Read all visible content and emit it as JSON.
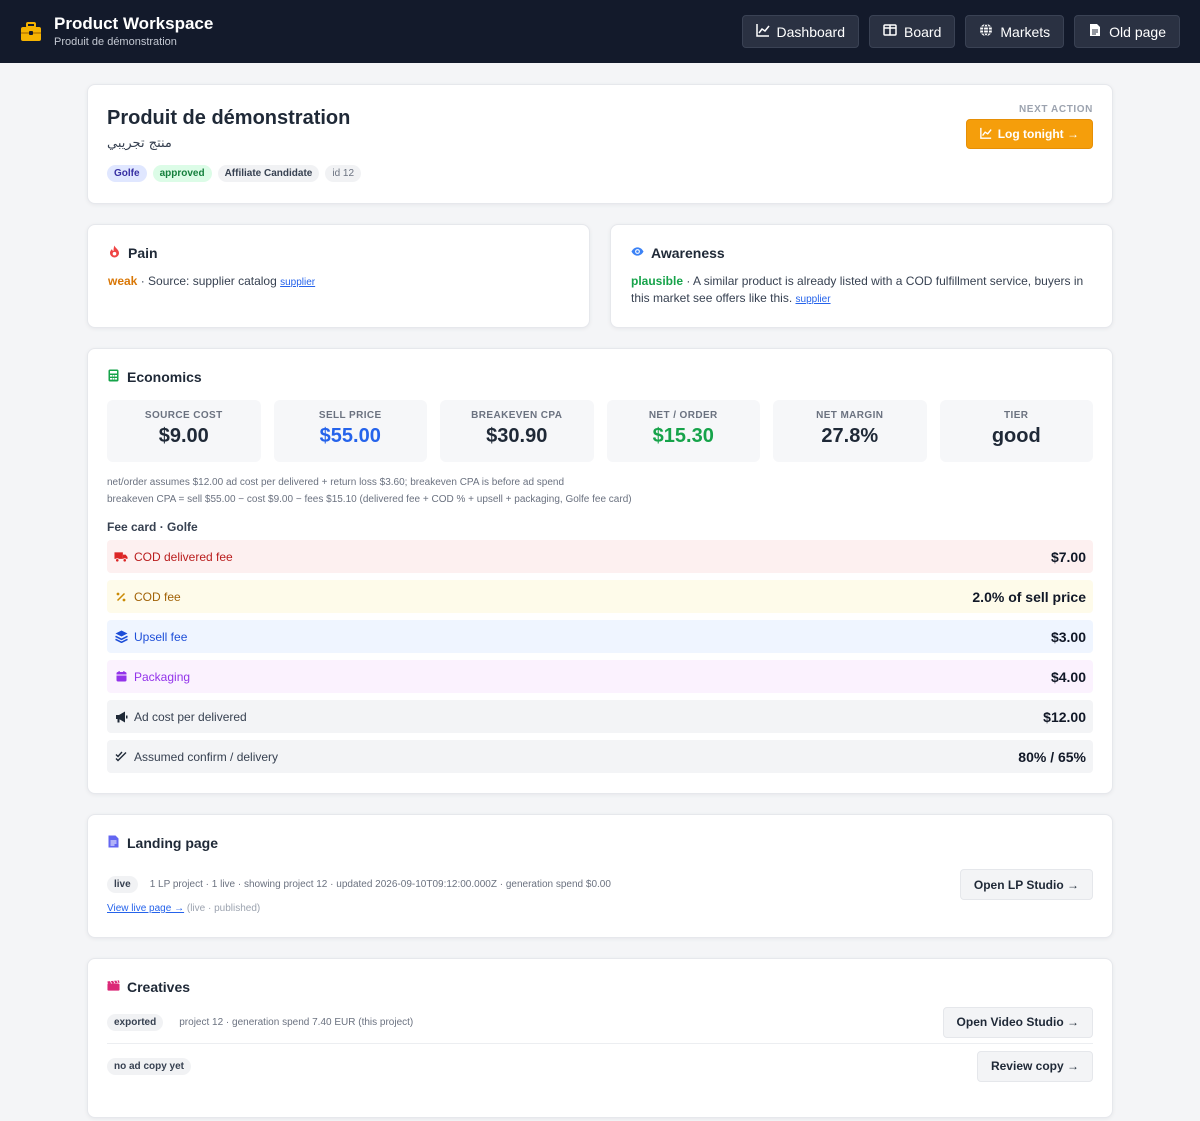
{
  "topbar": {
    "title": "Product Workspace",
    "subtitle": "Produit de démonstration",
    "nav": [
      {
        "label": "Dashboard",
        "icon": "chart-line-icon"
      },
      {
        "label": "Board",
        "icon": "board-icon"
      },
      {
        "label": "Markets",
        "icon": "globe-icon"
      },
      {
        "label": "Old page",
        "icon": "document-icon"
      }
    ]
  },
  "product": {
    "name": "Produit de démonstration",
    "name_ar": "منتج تجريبي",
    "chips": [
      "Golfe",
      "approved",
      "Affiliate Candidate",
      "id 12"
    ],
    "next_action_label": "NEXT ACTION",
    "next_action_button": "Log tonight →"
  },
  "pain": {
    "title": "Pain",
    "level": "weak",
    "text": " · Source: supplier catalog ",
    "link": "supplier"
  },
  "awareness": {
    "title": "Awareness",
    "level": "plausible",
    "text": " · A similar product is already listed with a COD fulfillment service, buyers in this market see offers like this. ",
    "link": "supplier"
  },
  "economics": {
    "title": "Economics",
    "stats": [
      {
        "label": "SOURCE COST",
        "value": "$9.00"
      },
      {
        "label": "SELL PRICE",
        "value": "$55.00"
      },
      {
        "label": "BREAKEVEN CPA",
        "value": "$30.90"
      },
      {
        "label": "NET / ORDER",
        "value": "$15.30"
      },
      {
        "label": "NET MARGIN",
        "value": "27.8%"
      },
      {
        "label": "TIER",
        "value": "good"
      }
    ],
    "note1": "net/order assumes $12.00 ad cost per delivered + return loss $3.60; breakeven CPA is before ad spend",
    "note2": "breakeven CPA = sell $55.00 − cost $9.00 − fees $15.10 (delivered fee + COD % + upsell + packaging, Golfe fee card)",
    "fee_card_title": "Fee card · Golfe",
    "fees": [
      {
        "label": "COD delivered fee",
        "value": "$7.00",
        "icon": "truck-icon"
      },
      {
        "label": "COD fee",
        "value": "2.0% of sell price",
        "icon": "percent-icon"
      },
      {
        "label": "Upsell fee",
        "value": "$3.00",
        "icon": "layers-icon"
      },
      {
        "label": "Packaging",
        "value": "$4.00",
        "icon": "package-icon"
      },
      {
        "label": "Ad cost per delivered",
        "value": "$12.00",
        "icon": "megaphone-icon"
      },
      {
        "label": "Assumed confirm / delivery",
        "value": "80% / 65%",
        "icon": "double-check-icon"
      }
    ]
  },
  "landing": {
    "title": "Landing page",
    "status": "live",
    "meta": "1 LP project · 1 live · showing project 12 · updated 2026-09-10T09:12:00.000Z · generation spend $0.00",
    "button": "Open LP Studio →",
    "link": "View live page →",
    "link_note": " (live · published)"
  },
  "creatives": {
    "title": "Creatives",
    "row1_status": "exported",
    "row1_meta": "project 12 · generation spend 7.40 EUR (this project)",
    "row1_button": "Open Video Studio →",
    "row2_status": "no ad copy yet",
    "row2_button": "Review copy →"
  },
  "colors": {
    "topbar_bg": "#131a2b",
    "accent_orange": "#f59e0b",
    "link_blue": "#2563eb",
    "positive_green": "#16a34a"
  }
}
